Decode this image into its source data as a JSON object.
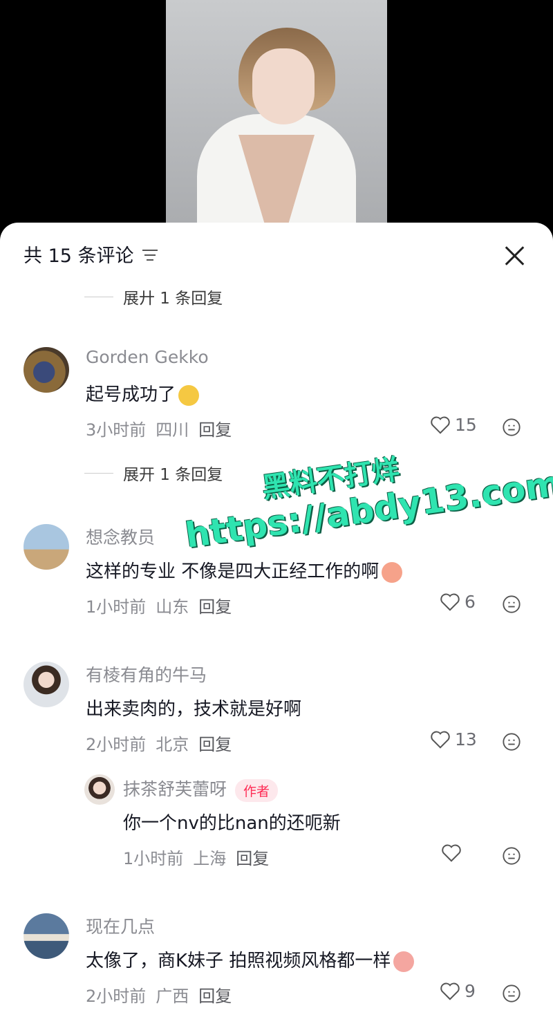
{
  "sheet": {
    "title": "共 15 条评论"
  },
  "expand_top": {
    "label": "展廾 1 条回复"
  },
  "expand_mid": {
    "label": "展开 1 条回复"
  },
  "comments": [
    {
      "author": "Gorden Gekko",
      "text": "起号成功了",
      "time": "3小时前",
      "location": "四川",
      "reply": "回复",
      "likes": "15"
    },
    {
      "author": "想念教员",
      "text": "这样的专业  不像是四大正经工作的啊",
      "time": "1小时前",
      "location": "山东",
      "reply": "回复",
      "likes": "6"
    },
    {
      "author": "有棱有角的牛马",
      "text": "出来卖肉的，技术就是好啊",
      "time": "2小时前",
      "location": "北京",
      "reply": "回复",
      "likes": "13"
    },
    {
      "author": "抹茶舒芙蕾呀",
      "badge": "作者",
      "text": "你一个nv的比nan的还呃新",
      "time": "1小时前",
      "location": "上海",
      "reply": "回复",
      "likes": ""
    },
    {
      "author": "现在几点",
      "text": "太像了，商K妹子 拍照视频风格都一样",
      "time": "2小时前",
      "location": "广西",
      "reply": "回复",
      "likes": "9"
    }
  ],
  "watermark": {
    "line1": "黑料不打烊",
    "line2": "https://abdy13.com"
  },
  "colors": {
    "accent": "#fe2c55",
    "watermark": "#2fe4b0"
  }
}
